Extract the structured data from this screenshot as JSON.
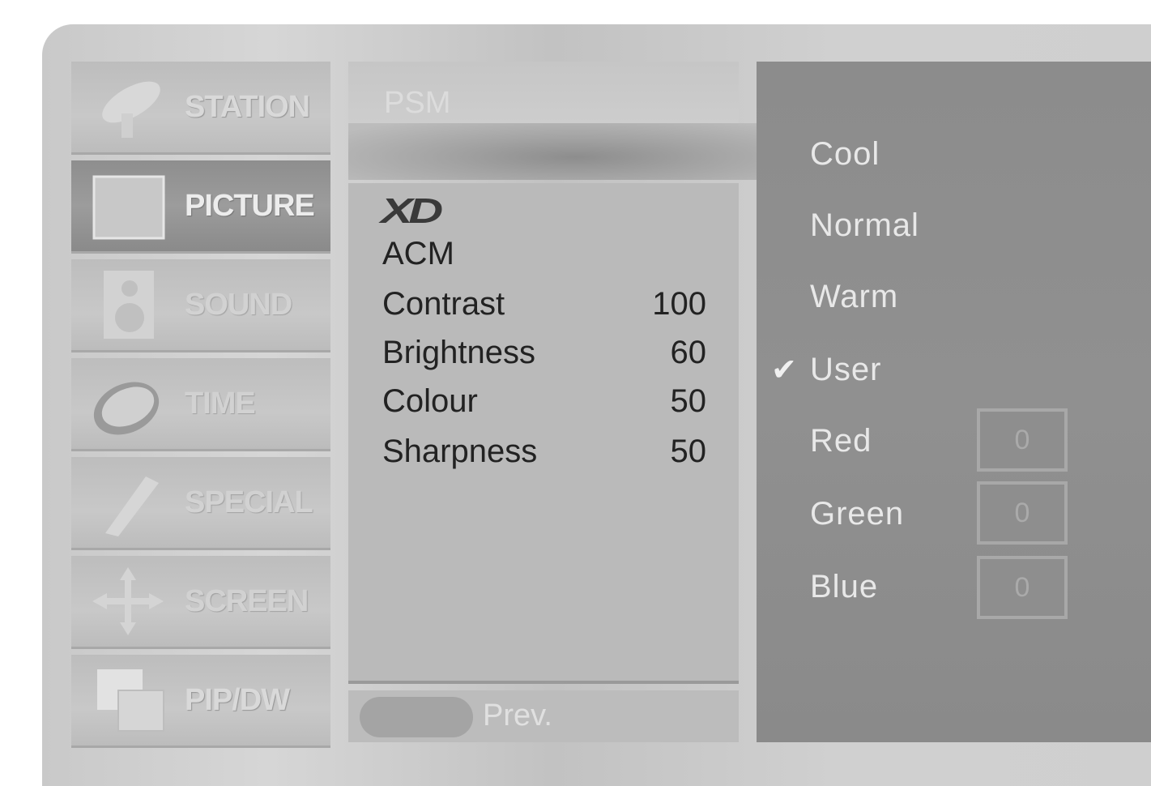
{
  "sidebar": {
    "items": [
      {
        "label": "STATION",
        "icon": "satellite-dish-icon",
        "active": false
      },
      {
        "label": "PICTURE",
        "icon": "picture-frame-icon",
        "active": true
      },
      {
        "label": "SOUND",
        "icon": "speaker-icon",
        "active": false
      },
      {
        "label": "TIME",
        "icon": "clock-icon",
        "active": false
      },
      {
        "label": "SPECIAL",
        "icon": "wrench-icon",
        "active": false
      },
      {
        "label": "SCREEN",
        "icon": "move-arrows-icon",
        "active": false
      },
      {
        "label": "PIP/DW",
        "icon": "multi-window-icon",
        "active": false
      }
    ]
  },
  "middle": {
    "header": "PSM",
    "logo": "XD",
    "items": [
      {
        "label": "ACM",
        "value": ""
      },
      {
        "label": "Contrast",
        "value": "100"
      },
      {
        "label": "Brightness",
        "value": "60"
      },
      {
        "label": "Colour",
        "value": "50"
      },
      {
        "label": "Sharpness",
        "value": "50"
      }
    ],
    "prev_label": "Prev."
  },
  "right": {
    "options": [
      "Cool",
      "Normal",
      "Warm",
      "User"
    ],
    "selected": "User",
    "check_glyph": "✔",
    "rgb": [
      {
        "label": "Red",
        "value": "0"
      },
      {
        "label": "Green",
        "value": "0"
      },
      {
        "label": "Blue",
        "value": "0"
      }
    ]
  }
}
